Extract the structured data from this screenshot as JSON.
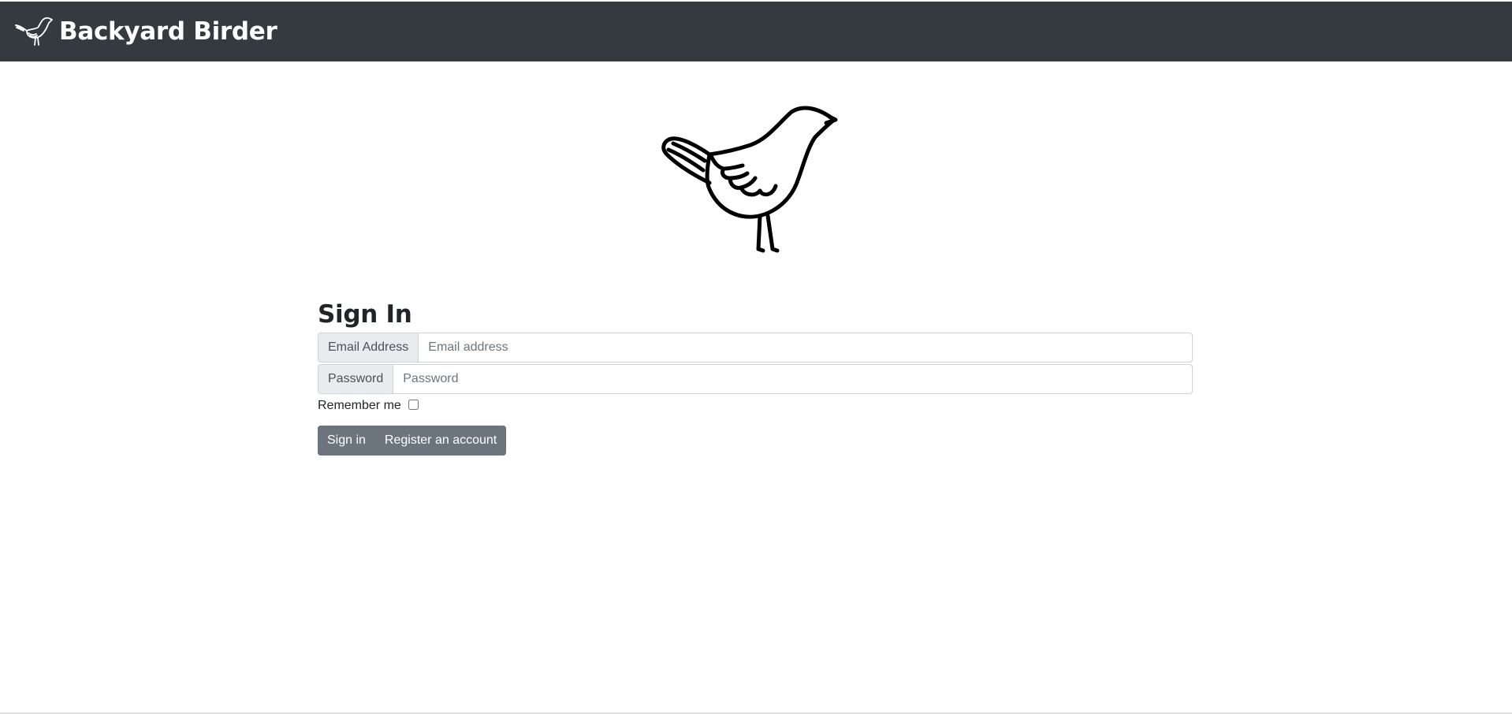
{
  "navbar": {
    "brand": "Backyard Birder",
    "logo_icon": "bird-logo-icon"
  },
  "hero": {
    "icon": "bird-illustration-icon"
  },
  "signin": {
    "title": "Sign In",
    "email_label": "Email Address",
    "email_placeholder": "Email address",
    "password_label": "Password",
    "password_placeholder": "Password",
    "remember_label": "Remember me",
    "remember_checked": false,
    "signin_button": "Sign in",
    "register_button": "Register an account"
  },
  "colors": {
    "navbar": "#343a40",
    "button": "#6c757d",
    "addon_bg": "#e9ecef",
    "border": "#ced4da"
  }
}
